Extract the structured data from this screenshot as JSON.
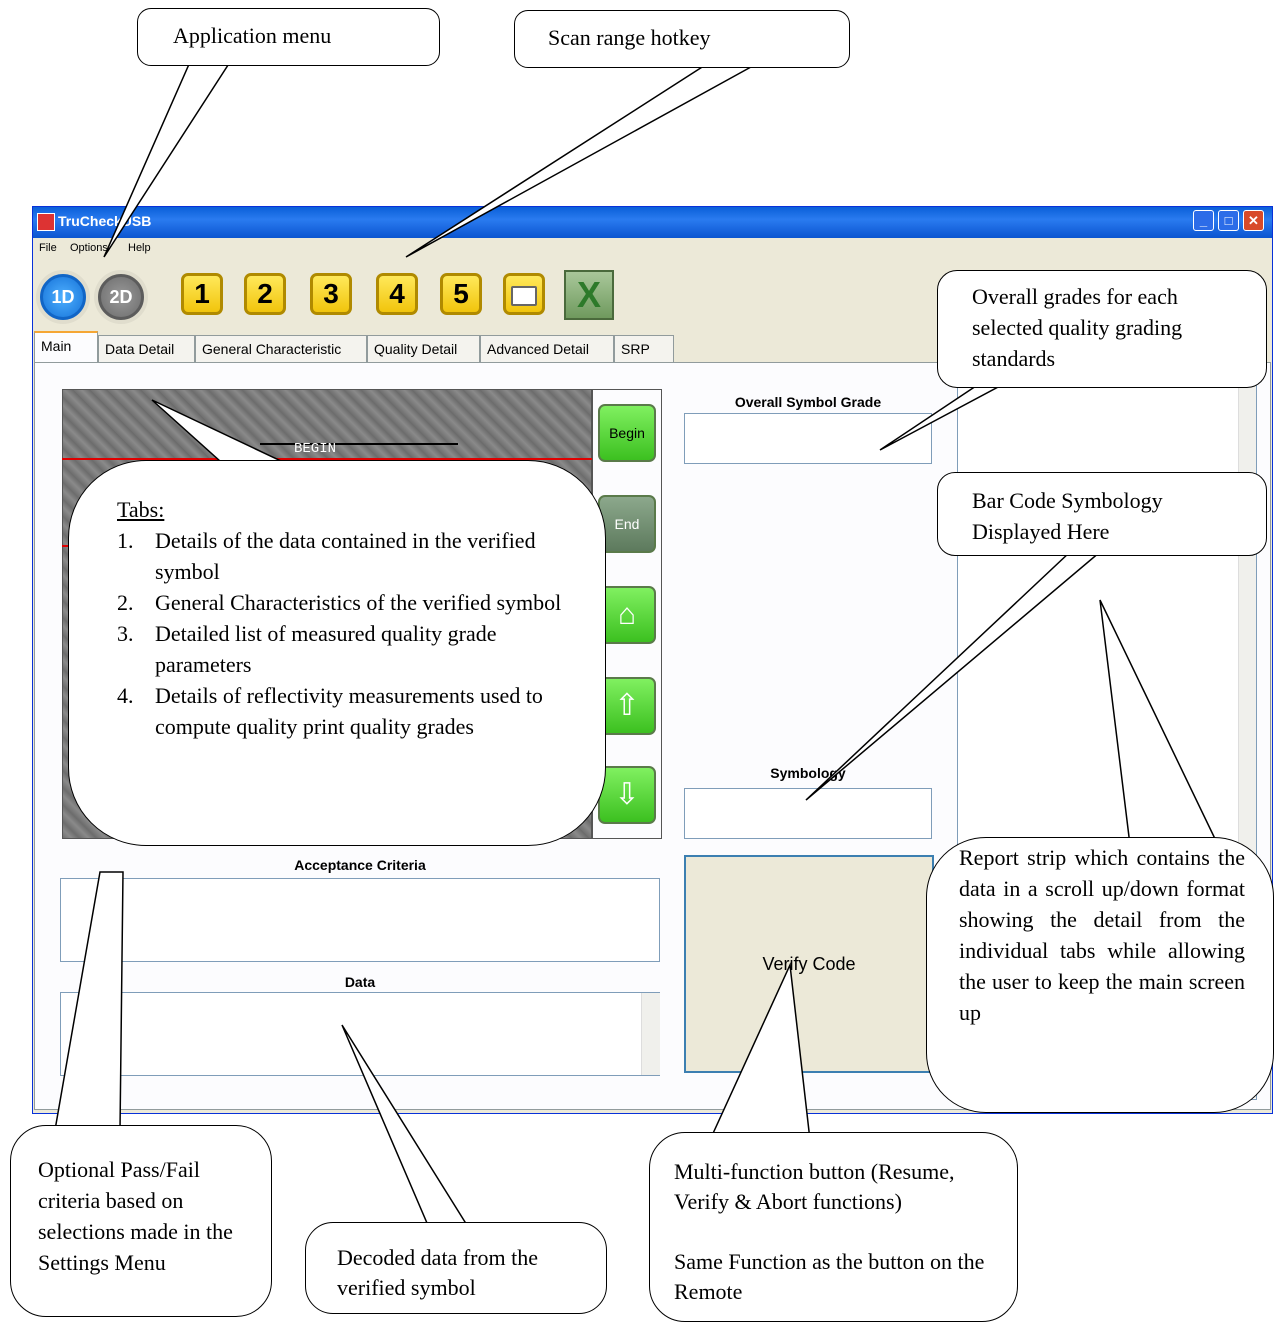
{
  "window": {
    "title": "TruCheckUSB"
  },
  "menu": [
    "File",
    "Options",
    "Help"
  ],
  "toolbar": {
    "mode_1d": "1D",
    "mode_2d": "2D",
    "scan_buttons": [
      "1",
      "2",
      "3",
      "4",
      "5"
    ],
    "print_icon": "printer-icon",
    "excel_icon": "excel-icon"
  },
  "tabs": [
    "Main",
    "Data Detail",
    "General Characteristic",
    "Quality Detail",
    "Advanced Detail",
    "SRP"
  ],
  "main": {
    "image_label": "BEGIN",
    "nav": {
      "begin": "Begin",
      "end": "End",
      "home_icon": "home-icon",
      "up_icon": "arrow-up-icon",
      "down_icon": "arrow-down-icon"
    },
    "overall_grade_label": "Overall Symbol Grade",
    "symbology_label": "Symbology",
    "acceptance_label": "Acceptance Criteria",
    "data_label": "Data",
    "verify_button": "Verify Code"
  },
  "callouts": {
    "app_menu": "Application menu",
    "scan_range": "Scan range hotkey",
    "overall_grades": "Overall grades for each selected quality grading standards",
    "symbology": "Bar Code Symbology Displayed Here",
    "tabs_title": "Tabs:",
    "tabs_list": [
      {
        "num": "1.",
        "text": "Details of the data contained in the verified symbol"
      },
      {
        "num": "2.",
        "text": "General Characteristics of the verified symbol"
      },
      {
        "num": "3.",
        "text": "Detailed list of measured quality grade parameters"
      },
      {
        "num": "4.",
        "text": "Details of reflectivity measurements used to compute quality print quality grades"
      }
    ],
    "report_strip": "Report strip which contains the data in a scroll up/down format showing the detail from the individual tabs while allowing the user to keep the main screen up",
    "pass_fail": "Optional Pass/Fail criteria based on selections made in the Settings Menu",
    "decoded": "Decoded data from the verified symbol",
    "multi_function": "Multi-function button (Resume, Verify & Abort functions)",
    "same_function": "Same Function as the button on the Remote"
  },
  "colors": {
    "titlebar": "#0a5fd8",
    "green_button": "#58d838",
    "yellow_button": "#f1c50c",
    "scan_line": "#e00000"
  }
}
